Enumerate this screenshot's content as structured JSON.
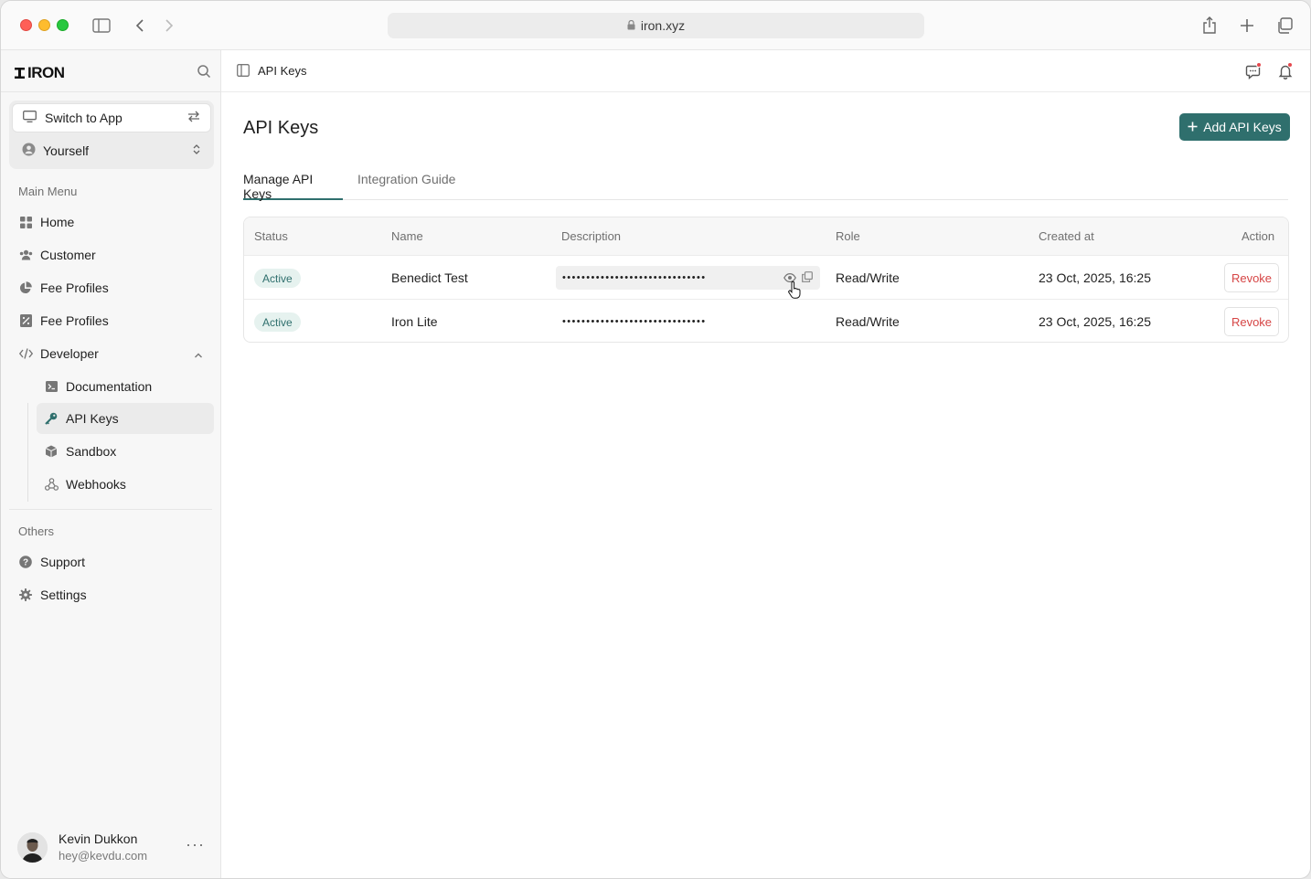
{
  "browser": {
    "url": "iron.xyz"
  },
  "sidebar": {
    "brand": "IRON",
    "switch_label": "Switch to App",
    "account_label": "Yourself",
    "main_menu_label": "Main Menu",
    "items": [
      {
        "label": "Home",
        "icon": "grid-icon"
      },
      {
        "label": "Customer",
        "icon": "users-icon"
      },
      {
        "label": "Fee Profiles",
        "icon": "pie-chart-icon"
      },
      {
        "label": "Fee Profiles",
        "icon": "receipt-icon"
      },
      {
        "label": "Developer",
        "icon": "code-icon"
      }
    ],
    "developer_items": [
      {
        "label": "Documentation",
        "icon": "terminal-icon"
      },
      {
        "label": "API Keys",
        "icon": "key-icon"
      },
      {
        "label": "Sandbox",
        "icon": "box-icon"
      },
      {
        "label": "Webhooks",
        "icon": "webhook-icon"
      }
    ],
    "others_label": "Others",
    "others_items": [
      {
        "label": "Support",
        "icon": "help-icon"
      },
      {
        "label": "Settings",
        "icon": "gear-icon"
      }
    ],
    "user": {
      "name": "Kevin Dukkon",
      "email": "hey@kevdu.com"
    }
  },
  "topbar": {
    "breadcrumb": "API Keys"
  },
  "page": {
    "title": "API Keys",
    "add_button": "Add API Keys",
    "tabs": [
      "Manage API Keys",
      "Integration Guide"
    ]
  },
  "table": {
    "headers": [
      "Status",
      "Name",
      "Description",
      "Role",
      "Created at",
      "Action"
    ],
    "rows": [
      {
        "status": "Active",
        "name": "Benedict Test",
        "description": "••••••••••••••••••••••••••••••",
        "role": "Read/Write",
        "created_at": "23 Oct, 2025, 16:25",
        "action": "Revoke"
      },
      {
        "status": "Active",
        "name": "Iron Lite",
        "description": "••••••••••••••••••••••••••••••",
        "role": "Read/Write",
        "created_at": "23 Oct, 2025, 16:25",
        "action": "Revoke"
      }
    ]
  },
  "colors": {
    "accent": "#2f6f6d",
    "danger": "#d64545",
    "badge_bg": "#e6f2ef"
  }
}
